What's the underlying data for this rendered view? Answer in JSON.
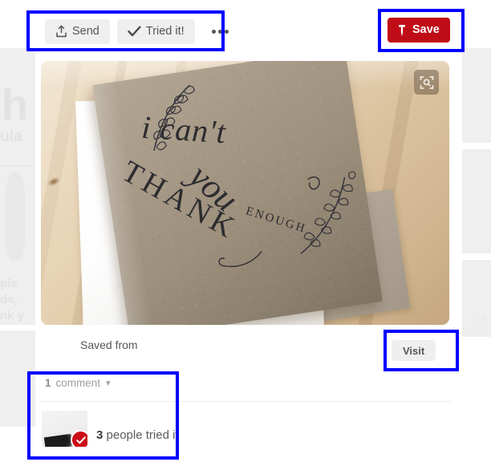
{
  "accent": {
    "brand_red": "#c00c17",
    "badge_red": "#cc0d17",
    "annotation_blue": "#0000ff",
    "pill_gray": "#efefef"
  },
  "toolbar": {
    "send_label": "Send",
    "send_icon": "share-upload-icon",
    "tried_label": "Tried it!",
    "tried_icon": "checkmark-icon",
    "more_label": "•••",
    "more_icon": "ellipsis-icon"
  },
  "save": {
    "label": "Save",
    "icon": "pushpin-icon"
  },
  "photo": {
    "alt": "Kraft paper greeting card with hand-lettered calligraphy reading i can't THANK you ENOUGH, resting on a white envelope on a light wood table",
    "zoom_icon": "zoom-magnifier-icon",
    "ink_line1": "i can't",
    "ink_line2": "THANK",
    "ink_line3": "you",
    "ink_line4": "ENOUGH"
  },
  "source": {
    "saved_from_label": "Saved from",
    "visit_label": "Visit"
  },
  "comments": {
    "count": "1",
    "word": "comment",
    "chevron_icon": "chevron-down-icon",
    "tried_count": "3",
    "tried_text": "people tried it",
    "thumbnail_name": "commenter-photo-thumbnail",
    "badge_icon": "tried-it-check-badge"
  },
  "background_ghost": {
    "heading_fragment": "h",
    "frag_ula": "ula",
    "frag_ple": "ple",
    "frag_ds": "ds,",
    "frag_nky": "nk y",
    "frag_right": "19"
  }
}
